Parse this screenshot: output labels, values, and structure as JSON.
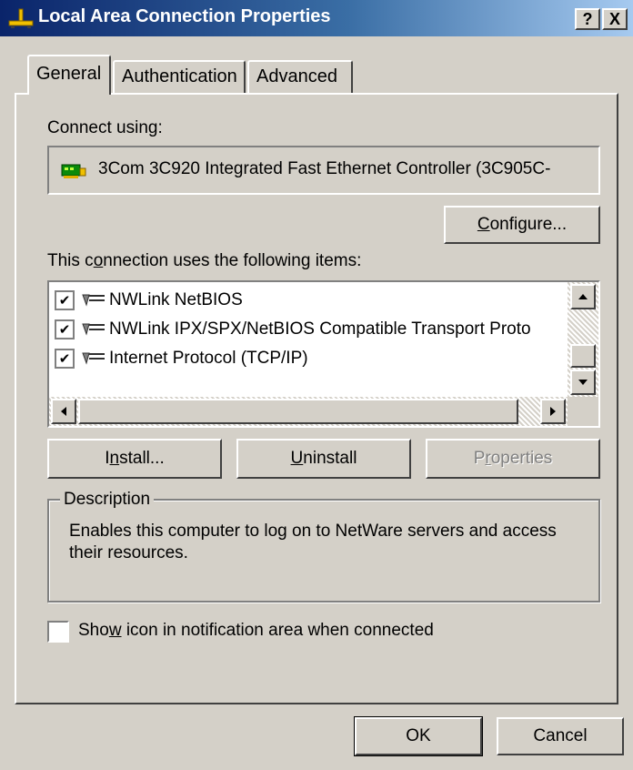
{
  "window": {
    "title": "Local Area Connection Properties",
    "help_button": "?",
    "close_button": "X"
  },
  "tabs": [
    {
      "label": "General",
      "active": true
    },
    {
      "label": "Authentication",
      "active": false
    },
    {
      "label": "Advanced",
      "active": false
    }
  ],
  "connect_using": {
    "label": "Connect using:",
    "adapter_name": "3Com 3C920 Integrated Fast Ethernet Controller (3C905C-"
  },
  "configure_button": {
    "pre": "",
    "key": "C",
    "post": "onfigure..."
  },
  "items_label": {
    "pre": "This c",
    "key": "o",
    "post": "nnection uses the following items:"
  },
  "items": [
    {
      "label": "NWLink NetBIOS",
      "checked": true
    },
    {
      "label": "NWLink IPX/SPX/NetBIOS Compatible Transport Proto",
      "checked": true
    },
    {
      "label": "Internet Protocol (TCP/IP)",
      "checked": true
    }
  ],
  "item_buttons": {
    "install": {
      "pre": "I",
      "key": "n",
      "post": "stall..."
    },
    "uninstall": {
      "pre": "",
      "key": "U",
      "post": "ninstall"
    },
    "properties": {
      "pre": "P",
      "key": "r",
      "post": "operties"
    }
  },
  "description": {
    "title": "Description",
    "text": "Enables this computer to log on to NetWare servers and access their resources."
  },
  "notify_checkbox": {
    "pre": "Sho",
    "key": "w",
    "post": " icon in notification area when connected",
    "checked": false
  },
  "footer": {
    "ok_label": "OK",
    "cancel_label": "Cancel"
  },
  "colors": {
    "titlebar_start": "#0a246a",
    "titlebar_end": "#a6caf0",
    "face": "#d4d0c8"
  }
}
